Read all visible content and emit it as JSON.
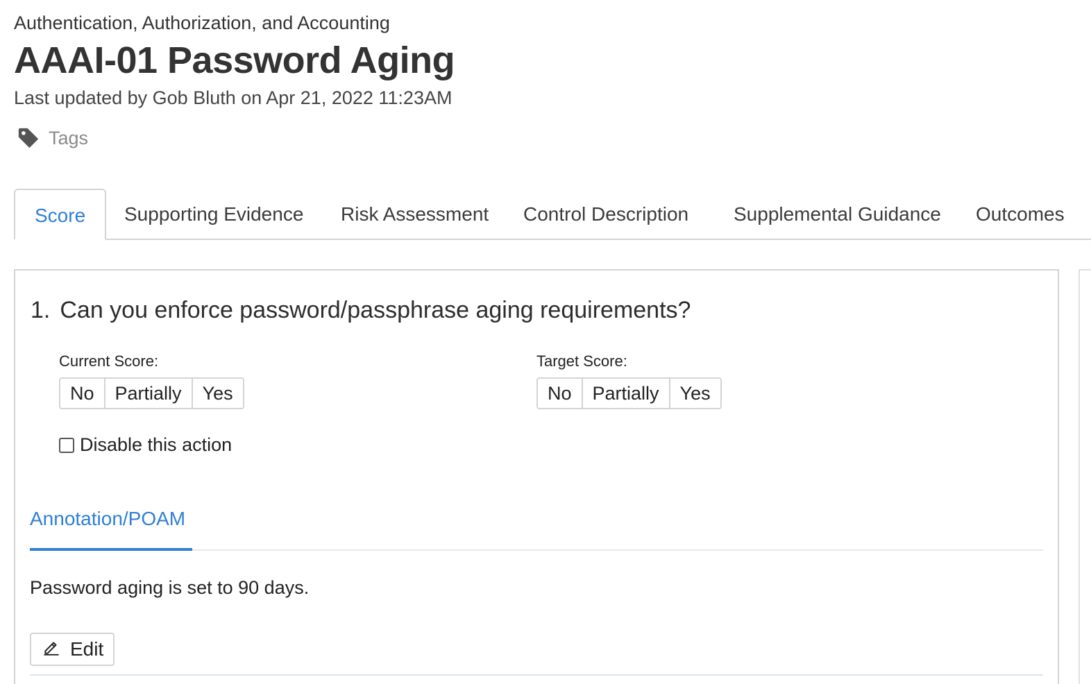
{
  "header": {
    "category": "Authentication, Authorization, and Accounting",
    "title": "AAAI-01 Password Aging",
    "updated": "Last updated by Gob Bluth on Apr 21, 2022 11:23AM",
    "tags_label": "Tags"
  },
  "tabs": [
    {
      "label": "Score",
      "active": true
    },
    {
      "label": "Supporting Evidence",
      "active": false
    },
    {
      "label": "Risk Assessment",
      "active": false
    },
    {
      "label": "Control Description",
      "active": false
    },
    {
      "label": "Supplemental Guidance",
      "active": false
    },
    {
      "label": "Outcomes",
      "active": false
    }
  ],
  "question": {
    "number": "1.",
    "text": "Can you enforce password/passphrase aging requirements?"
  },
  "current_score": {
    "label": "Current Score:",
    "options": [
      "No",
      "Partially",
      "Yes"
    ]
  },
  "target_score": {
    "label": "Target Score:",
    "options": [
      "No",
      "Partially",
      "Yes"
    ]
  },
  "disable_action": {
    "label": "Disable this action",
    "checked": false
  },
  "annotation": {
    "tab_label": "Annotation/POAM",
    "text": "Password aging is set to 90 days.",
    "edit_label": "Edit"
  },
  "colors": {
    "accent": "#2f7fd5",
    "border": "#d4d4d5"
  },
  "icons": {
    "tags": "tag-icon",
    "edit": "pencil-icon"
  }
}
